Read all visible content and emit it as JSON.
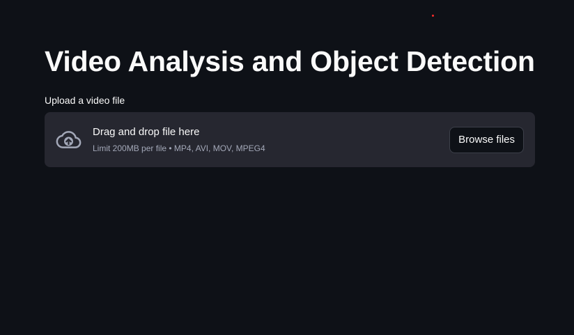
{
  "page": {
    "title": "Video Analysis and Object Detection"
  },
  "uploader": {
    "label": "Upload a video file",
    "instructions": "Drag and drop file here",
    "limit_text": "Limit 200MB per file • MP4, AVI, MOV, MPEG4",
    "browse_label": "Browse files",
    "icon": "cloud-upload-icon"
  },
  "colors": {
    "background": "#0e1117",
    "dropzone_bg": "#262730",
    "text": "#fafafa",
    "muted_text": "#a3a8b8",
    "status_dot": "#ff2b2b"
  }
}
